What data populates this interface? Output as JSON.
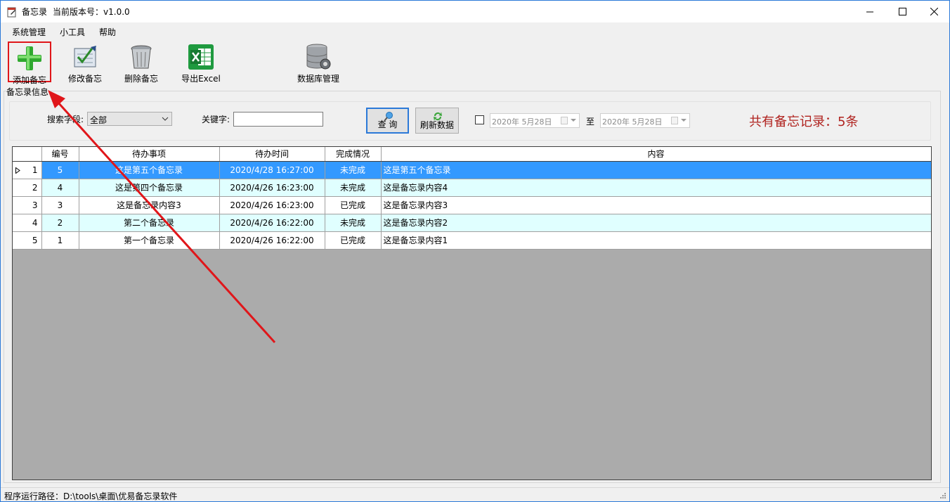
{
  "window": {
    "title": "备忘录",
    "version": "当前版本号：v1.0.0",
    "minimize_glyph": "—",
    "maximize_glyph": "☐",
    "close_glyph": "✕"
  },
  "menu": [
    "系统管理",
    "小工具",
    "帮助"
  ],
  "toolbar": {
    "add_label": "添加备忘",
    "edit_label": "修改备忘",
    "delete_label": "删除备忘",
    "export_label": "导出Excel",
    "db_label": "数据库管理"
  },
  "group_title": "备忘录信息",
  "search": {
    "field_label": "搜索字段:",
    "field_value": "全部",
    "keyword_label": "关键字:",
    "keyword_value": "",
    "query_label": "查  询",
    "refresh_label": "刷新数据",
    "date_from": "2020年  5月28日",
    "to_label": "至",
    "date_to": "2020年  5月28日",
    "date_filter_checked": false,
    "record_count": "共有备忘记录：5条"
  },
  "grid": {
    "columns": [
      "编号",
      "待办事项",
      "待办时间",
      "完成情况",
      "内容"
    ],
    "rows": [
      {
        "index": "1",
        "id": "5",
        "item": "这是第五个备忘录",
        "time": "2020/4/28 16:27:00",
        "status": "未完成",
        "content": "这是第五个备忘录",
        "selected": true
      },
      {
        "index": "2",
        "id": "4",
        "item": "这是第四个备忘录",
        "time": "2020/4/26 16:23:00",
        "status": "未完成",
        "content": "这是备忘录内容4"
      },
      {
        "index": "3",
        "id": "3",
        "item": "这是备忘录内容3",
        "time": "2020/4/26 16:23:00",
        "status": "已完成",
        "content": "这是备忘录内容3"
      },
      {
        "index": "4",
        "id": "2",
        "item": "第二个备忘录",
        "time": "2020/4/26 16:22:00",
        "status": "未完成",
        "content": "这是备忘录内容2"
      },
      {
        "index": "5",
        "id": "1",
        "item": "第一个备忘录",
        "time": "2020/4/26 16:22:00",
        "status": "已完成",
        "content": "这是备忘录内容1"
      }
    ]
  },
  "status_bar": "程序运行路径：D:\\tools\\桌面\\优易备忘录软件",
  "colors": {
    "selection": "#3399ff",
    "alt_row": "#e0ffff",
    "count_text": "#b0231f",
    "annotation": "#e0161a"
  },
  "icons": {
    "add": "green-plus-icon",
    "edit": "notepad-check-icon",
    "delete": "trash-bin-icon",
    "export": "excel-icon",
    "db": "database-gear-icon"
  }
}
